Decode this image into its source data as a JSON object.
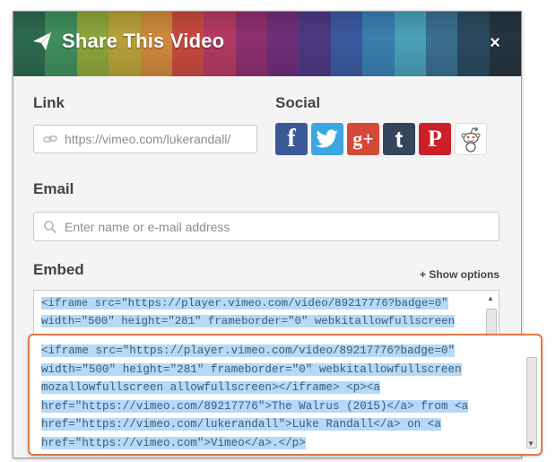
{
  "dialog": {
    "title": "Share This Video",
    "close_label": "×",
    "header_colors": [
      "#2d6a4f",
      "#3f8f5c",
      "#8ea63b",
      "#b9a23a",
      "#d08a3c",
      "#c84a3e",
      "#b43a63",
      "#8f2f6f",
      "#6e2f7a",
      "#4b3a84",
      "#3b5aa0",
      "#3a7fb0",
      "#4aa0b8",
      "#3a6f8f",
      "#2b4a5f",
      "#26343f"
    ]
  },
  "link": {
    "label": "Link",
    "value": "https://vimeo.com/lukerandall/",
    "icon": "link-icon"
  },
  "social": {
    "label": "Social",
    "items": [
      {
        "name": "facebook",
        "glyph": "f",
        "color": "#3b5998"
      },
      {
        "name": "twitter",
        "glyph": "t",
        "color": "#3aa7e0"
      },
      {
        "name": "google-plus",
        "glyph": "g+",
        "color": "#d34836"
      },
      {
        "name": "tumblr",
        "glyph": "t",
        "color": "#35465c"
      },
      {
        "name": "pinterest",
        "glyph": "P",
        "color": "#cb2027"
      },
      {
        "name": "reddit",
        "glyph": "",
        "color": "#ffffff"
      }
    ]
  },
  "email": {
    "label": "Email",
    "placeholder": "Enter name or e-mail address",
    "icon": "search-icon"
  },
  "embed": {
    "label": "Embed",
    "show_options": "+ Show options",
    "preview_lines": [
      "<iframe src=\"https://player.vimeo.com/video/89217776?badge=0\"",
      "width=\"500\" height=\"281\" frameborder=\"0\" webkitallowfullscreen"
    ],
    "zoom_lines": [
      "<iframe src=\"https://player.vimeo.com/video/89217776?badge=0\"",
      "width=\"500\" height=\"281\" frameborder=\"0\" webkitallowfullscreen",
      "mozallowfullscreen allowfullscreen></iframe> <p><a",
      "href=\"https://vimeo.com/89217776\">The Walrus (2015)</a> from <a",
      "href=\"https://vimeo.com/lukerandall\">Luke Randall</a> on <a",
      "href=\"https://vimeo.com\">Vimeo</a>.</p>"
    ],
    "highlight_color": "#b6d9f7",
    "callout_color": "#e07b45"
  }
}
